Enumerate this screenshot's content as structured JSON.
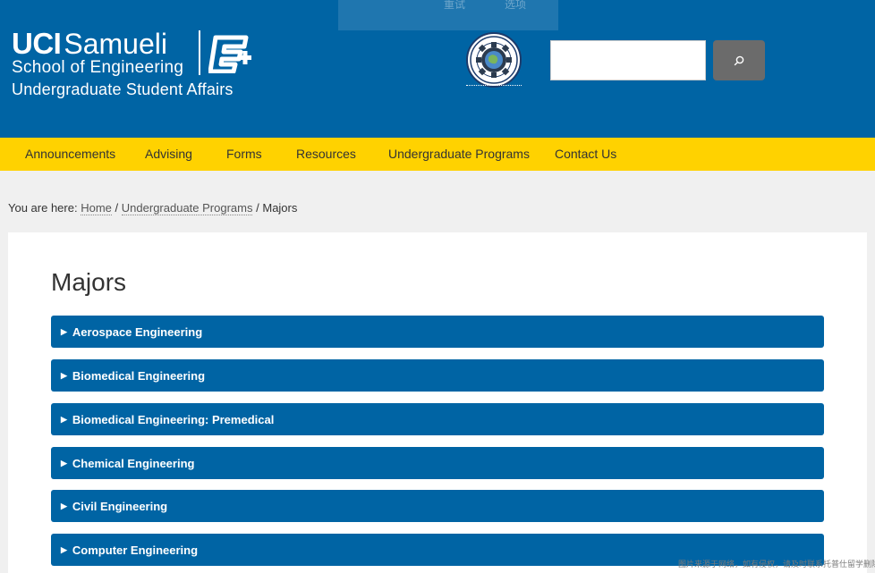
{
  "header": {
    "logo": {
      "uci": "UCI",
      "samueli": "Samueli",
      "school": "School of Engineering",
      "dept": "Undergraduate Student Affairs"
    },
    "ghost_items": [
      "重试",
      "选项"
    ],
    "peer_badge_icon": "engineering-peer-advisors-seal",
    "search": {
      "value": "",
      "button_icon": "search-icon"
    }
  },
  "nav": {
    "items": [
      "Announcements",
      "Advising",
      "Forms",
      "Resources",
      "Undergraduate Programs",
      "Contact Us"
    ]
  },
  "breadcrumb": {
    "prefix": "You are here:",
    "items": [
      "Home",
      "Undergraduate Programs",
      "Majors"
    ],
    "separator": "/"
  },
  "main": {
    "title": "Majors",
    "accordion_marker": "▶",
    "majors": [
      "Aerospace Engineering",
      "Biomedical Engineering",
      "Biomedical Engineering: Premedical",
      "Chemical Engineering",
      "Civil Engineering",
      "Computer Engineering"
    ]
  },
  "watermark": "图片来源于网络，如有侵权，请及时联系托普仕留学删除",
  "colors": {
    "brand_blue": "#0064a4",
    "nav_gold": "#ffd200",
    "search_button": "#6b6b6b"
  }
}
